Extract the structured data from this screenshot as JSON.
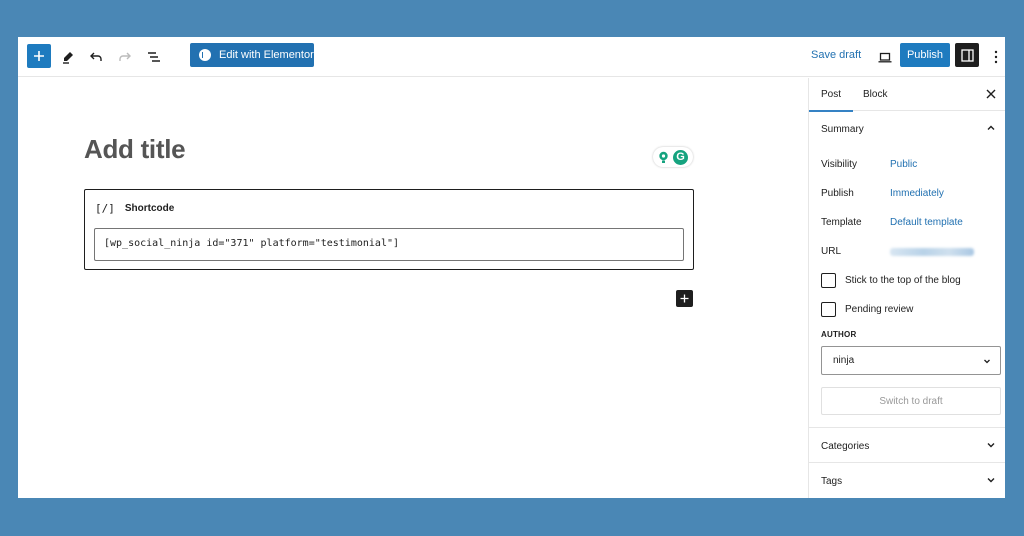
{
  "toolbar": {
    "add_block_icon": "plus-icon",
    "tools_icon": "pen-icon",
    "undo_icon": "undo-icon",
    "redo_icon": "redo-icon",
    "outline_icon": "list-view-icon",
    "elementor_label": "Edit with Elementor",
    "save_draft_label": "Save draft",
    "preview_icon": "laptop-icon",
    "publish_label": "Publish",
    "settings_icon": "sidebar-toggle-icon",
    "more_icon": "more-vertical-icon"
  },
  "editor": {
    "title_placeholder": "Add title",
    "blocks": [
      {
        "type": "shortcode",
        "icon_text": "[/]",
        "label": "Shortcode",
        "value": "[wp_social_ninja id=\"371\" platform=\"testimonial\"]"
      }
    ]
  },
  "sidebar": {
    "tabs": [
      {
        "label": "Post",
        "active": true
      },
      {
        "label": "Block",
        "active": false
      }
    ],
    "summary": {
      "title": "Summary",
      "rows": [
        {
          "label": "Visibility",
          "value": "Public"
        },
        {
          "label": "Publish",
          "value": "Immediately"
        },
        {
          "label": "Template",
          "value": "Default template"
        },
        {
          "label": "URL",
          "value": ""
        }
      ],
      "checkboxes": [
        {
          "label": "Stick to the top of the blog",
          "checked": false
        },
        {
          "label": "Pending review",
          "checked": false
        }
      ],
      "author_label": "AUTHOR",
      "author_value": "ninja",
      "switch_draft_label": "Switch to draft"
    },
    "panels": [
      {
        "title": "Categories"
      },
      {
        "title": "Tags"
      }
    ]
  },
  "colors": {
    "background": "#4a87b5",
    "accent": "#2271b1",
    "dark": "#1e1e1e"
  }
}
